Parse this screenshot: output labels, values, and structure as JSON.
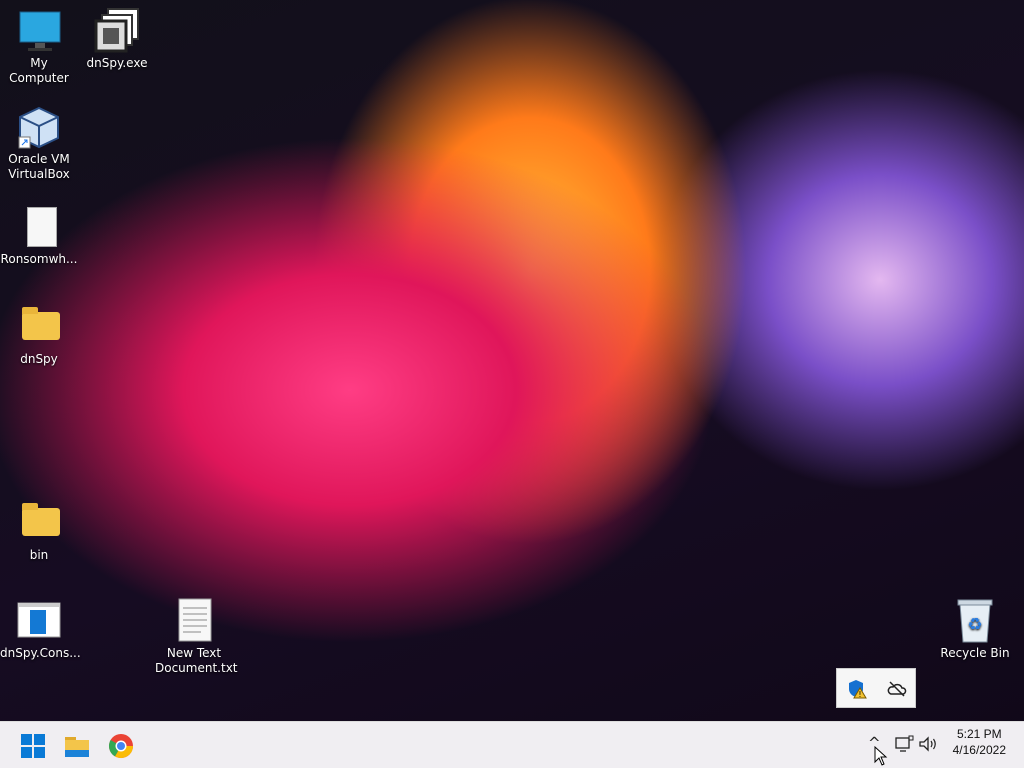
{
  "desktop_icons": [
    {
      "label": "My Computer",
      "icon": "monitor-icon"
    },
    {
      "label": "dnSpy.exe",
      "icon": "window-stack-icon"
    },
    {
      "label": "Oracle VM VirtualBox",
      "icon": "virtualbox-icon"
    },
    {
      "label": "Ronsomwh...",
      "icon": "document-icon"
    },
    {
      "label": "dnSpy",
      "icon": "folder-icon"
    },
    {
      "label": "bin",
      "icon": "folder-icon"
    },
    {
      "label": "dnSpy.Cons...",
      "icon": "console-app-icon"
    },
    {
      "label": "New Text Document.txt",
      "icon": "text-file-icon"
    },
    {
      "label": "Recycle Bin",
      "icon": "recycle-bin-icon"
    }
  ],
  "taskbar": {
    "clock_time": "5:21 PM",
    "clock_date": "4/16/2022",
    "overflow_glyph": "^"
  },
  "tray_popup": {
    "items": [
      "windows-security-warning-icon",
      "onedrive-offline-icon"
    ]
  },
  "colors": {
    "taskbar_bg": "#f0eef2",
    "folder": "#f3c54a",
    "start_blue": "#0a7ad6"
  }
}
